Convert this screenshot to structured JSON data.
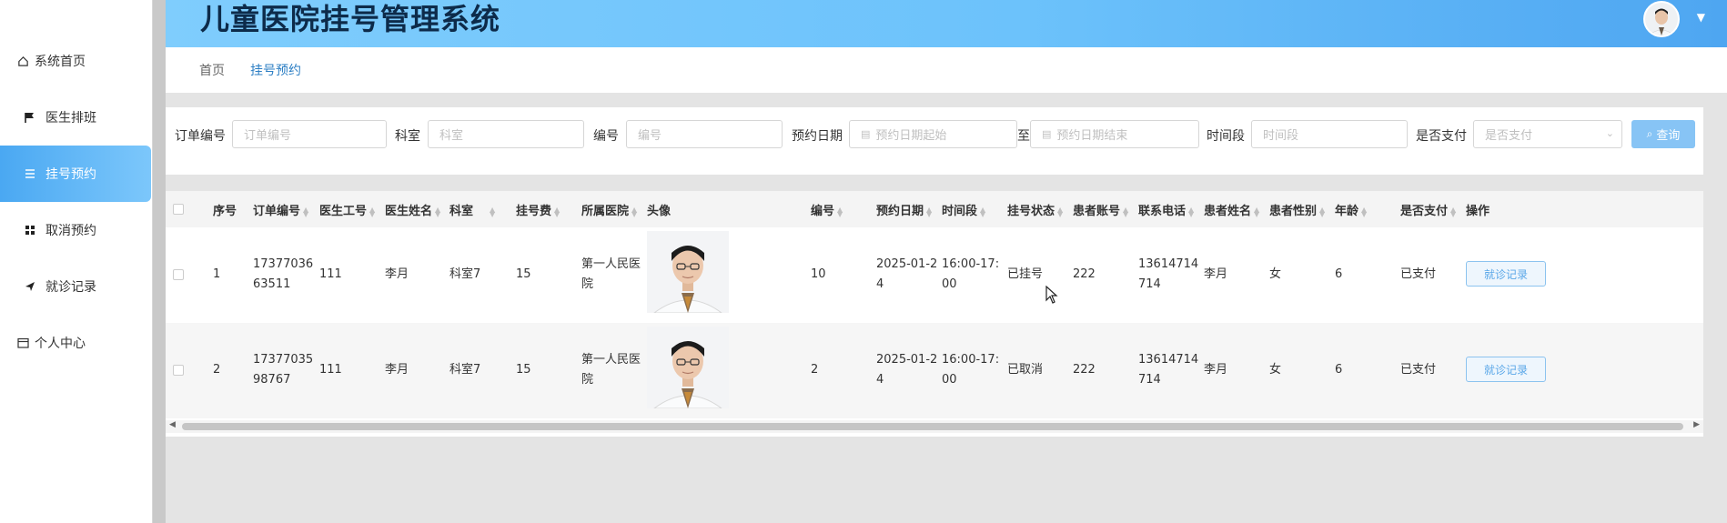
{
  "header": {
    "title": "儿童医院挂号管理系统"
  },
  "sidebar": {
    "items": [
      {
        "label": "系统首页",
        "icon": "home-icon"
      },
      {
        "label": "医生排班",
        "icon": "flag-icon"
      },
      {
        "label": "挂号预约",
        "icon": "list-icon"
      },
      {
        "label": "取消预约",
        "icon": "grid-icon"
      },
      {
        "label": "就诊记录",
        "icon": "send-icon"
      },
      {
        "label": "个人中心",
        "icon": "calendar-icon"
      }
    ]
  },
  "breadcrumb": {
    "items": [
      "首页",
      "挂号预约"
    ]
  },
  "search": {
    "order_label": "订单编号",
    "order_ph": "订单编号",
    "dept_label": "科室",
    "dept_ph": "科室",
    "num_label": "编号",
    "num_ph": "编号",
    "date_label": "预约日期",
    "date_start_ph": "预约日期起始",
    "date_sep": "至",
    "date_end_ph": "预约日期结束",
    "slot_label": "时间段",
    "slot_ph": "时间段",
    "paid_label": "是否支付",
    "paid_ph": "是否支付",
    "query_label": "查询"
  },
  "table": {
    "columns": [
      "序号",
      "订单编号",
      "医生工号",
      "医生姓名",
      "科室",
      "挂号费",
      "所属医院",
      "头像",
      "编号",
      "预约日期",
      "时间段",
      "挂号状态",
      "患者账号",
      "联系电话",
      "患者姓名",
      "患者性别",
      "年龄",
      "是否支付",
      "操作"
    ],
    "rows": [
      {
        "index": "1",
        "order_no": "1737703663511",
        "doctor_id": "111",
        "doctor_name": "李月",
        "dept": "科室7",
        "fee": "15",
        "hospital": "第一人民医院",
        "number": "10",
        "date": "2025-01-24",
        "slot": "16:00-17:00",
        "status": "已挂号",
        "patient_account": "222",
        "phone": "13614714714",
        "patient_name": "李月",
        "gender": "女",
        "age": "6",
        "paid": "已支付",
        "action": "就诊记录"
      },
      {
        "index": "2",
        "order_no": "1737703598767",
        "doctor_id": "111",
        "doctor_name": "李月",
        "dept": "科室7",
        "fee": "15",
        "hospital": "第一人民医院",
        "number": "2",
        "date": "2025-01-24",
        "slot": "16:00-17:00",
        "status": "已取消",
        "patient_account": "222",
        "phone": "13614714714",
        "patient_name": "李月",
        "gender": "女",
        "age": "6",
        "paid": "已支付",
        "action": "就诊记录"
      }
    ]
  },
  "colors": {
    "accent": "#4aa8f2",
    "header_title": "#0d2b4a",
    "button_text": "#5aa7e8"
  }
}
